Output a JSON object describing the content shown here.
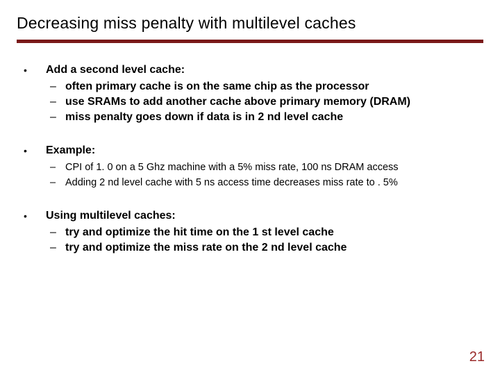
{
  "title": "Decreasing miss penalty with multilevel caches",
  "blocks": [
    {
      "lead": "Add a second level cache:",
      "bold": true,
      "subs": [
        "often primary cache is on the same chip as the processor",
        "use SRAMs to add another cache above primary memory (DRAM)",
        "miss penalty goes down if data is in 2 nd level cache"
      ],
      "subs_bold": true
    },
    {
      "lead": "Example:",
      "bold": true,
      "subs": [
        "CPI of 1. 0 on a 5 Ghz machine with a 5% miss rate, 100 ns DRAM access",
        "Adding 2 nd level cache with 5 ns access time decreases miss rate to . 5%"
      ],
      "subs_bold": false
    },
    {
      "lead": "Using multilevel caches:",
      "bold": true,
      "subs": [
        "try and optimize the hit time on the 1 st level cache",
        "try and optimize the miss rate on the 2 nd level cache"
      ],
      "subs_bold": true
    }
  ],
  "page_number": "21",
  "colors": {
    "rule": "#7a1a1a",
    "pagenum": "#9a2a2a"
  }
}
